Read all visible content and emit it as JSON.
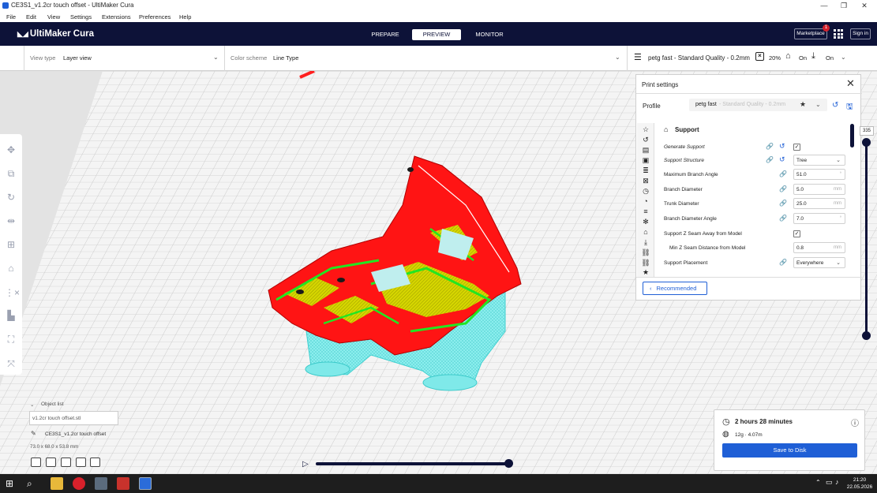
{
  "window": {
    "title": "CE3S1_v1.2cr touch offset - UltiMaker Cura",
    "minimize": "—",
    "maximize": "❐",
    "close": "✕"
  },
  "menu": [
    "File",
    "Edit",
    "View",
    "Settings",
    "Extensions",
    "Preferences",
    "Help"
  ],
  "header": {
    "logo": "UltiMaker Cura",
    "stages": [
      "PREPARE",
      "PREVIEW",
      "MONITOR"
    ],
    "active_stage": "PREVIEW",
    "marketplace": "Marketplace",
    "marketplace_badge": "1",
    "signin": "Sign in"
  },
  "toolbar": {
    "view_type_label": "View type",
    "view_type_value": "Layer view",
    "color_scheme_label": "Color scheme",
    "color_scheme_value": "Line Type",
    "profile_summary": "petg fast - Standard Quality - 0.2mm",
    "infill": "20%",
    "support": "On",
    "adhesion": "On"
  },
  "print_settings": {
    "title": "Print settings",
    "profile_label": "Profile",
    "profile_name": "petg fast",
    "profile_quality": "- Standard Quality - 0.2mm",
    "section": "Support",
    "rows": [
      {
        "label": "Generate Support",
        "type": "check",
        "checked": true,
        "italic": true,
        "link": true,
        "reset": true
      },
      {
        "label": "Support Structure",
        "type": "select",
        "value": "Tree",
        "italic": true,
        "link": true,
        "reset": true
      },
      {
        "label": "Maximum Branch Angle",
        "type": "input",
        "value": "51.0",
        "unit": "°",
        "link": true
      },
      {
        "label": "Branch Diameter",
        "type": "input",
        "value": "5.0",
        "unit": "mm",
        "link": true
      },
      {
        "label": "Trunk Diameter",
        "type": "input",
        "value": "25.0",
        "unit": "mm",
        "link": true
      },
      {
        "label": "Branch Diameter Angle",
        "type": "input",
        "value": "7.0",
        "unit": "°",
        "link": true
      },
      {
        "label": "Support Z Seam Away from Model",
        "type": "check",
        "checked": true
      },
      {
        "label": "Min Z Seam Distance from Model",
        "type": "input",
        "value": "0.8",
        "unit": "mm",
        "indent": true
      },
      {
        "label": "Support Placement",
        "type": "select",
        "value": "Everywhere",
        "link": true
      }
    ],
    "recommended_button": "Recommended"
  },
  "layer_slider": {
    "value": "335"
  },
  "object_list": {
    "header": "Object list",
    "file": "v1.2cr touch offset.stl",
    "object_name": "CE3S1_v1.2cr touch offset",
    "dimensions": "73.0 x 68.0 x 53.8 mm"
  },
  "estimate": {
    "time": "2 hours 28 minutes",
    "material": "12g · 4.07m",
    "save_button": "Save to Disk"
  },
  "taskbar": {
    "time": "21:20",
    "date": "22.05.2026"
  },
  "colors": {
    "navy": "#0d1238",
    "accent": "#1f5fd6",
    "wall": "#ff1a1a",
    "support": "#5ee8e8",
    "infill": "#e4e400",
    "skin": "#1ee81e"
  }
}
